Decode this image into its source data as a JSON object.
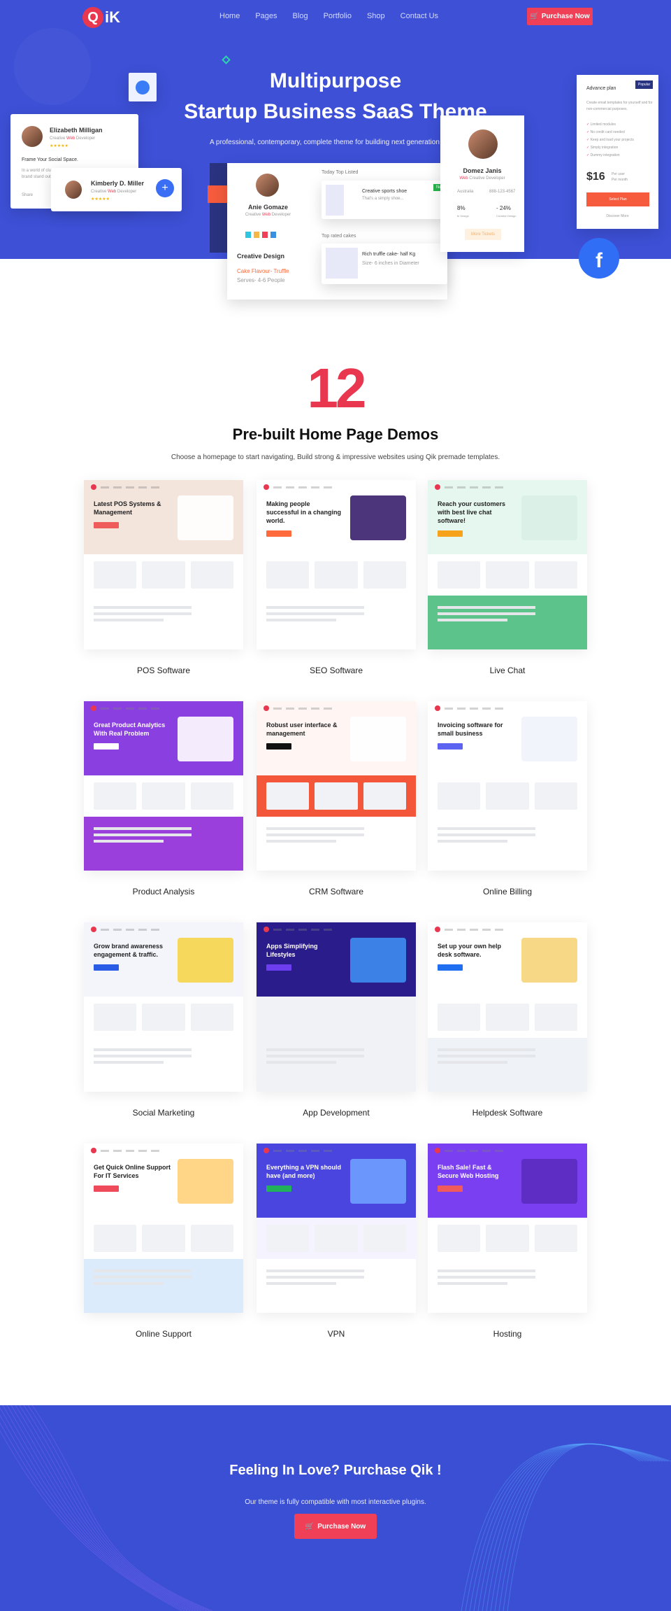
{
  "brand": {
    "logo_letter": "Q",
    "logo_rest": "iK"
  },
  "nav": [
    "Home",
    "Pages",
    "Blog",
    "Portfolio",
    "Shop",
    "Contact Us"
  ],
  "purchase_label": "Purchase Now",
  "colors": {
    "primary": "#3d50d6",
    "accent": "#ef4058",
    "number": "#e8374f"
  },
  "hero": {
    "title_line1": "Multipurpose",
    "title_line2": "Startup Business SaaS Theme",
    "subtitle": "A professional, contemporary, complete theme for building next generation w",
    "profile1": {
      "name": "Elizabeth Milligan",
      "role_pre": "Creative ",
      "role_hl": "Web",
      "role_post": " Developer",
      "heading": "Frame Your Social Space.",
      "text1": "In a world of clu",
      "text2": "brand stand out",
      "share": "Share"
    },
    "profile2": {
      "name": "Kimberly D. Miller",
      "role_pre": "Creative ",
      "role_hl": "Web",
      "role_post": " Developer"
    },
    "dash": {
      "name": "Anie Gomaze",
      "role_pre": "Creative ",
      "role_hl": "Web",
      "role_post": " Developer",
      "section": "Creative Design",
      "flavour": "Cake Flavour- Truffle",
      "serves": "Serves- 4-6 People",
      "list1_title": "Today Top Listed",
      "item1": "Creative sports shoe",
      "item1_sub": "That's a simply shoe...",
      "badge": "New",
      "list2_title": "Top rated cakes",
      "item2": "Rich truffle cake- half Kg",
      "item2_sub": "Size- 6 inches in Diameter"
    },
    "profile3": {
      "name": "Domez Janis",
      "role_hl": "Web",
      "role_post": " Creative Developer",
      "location": "Australia",
      "phone": "888-123-4567",
      "stat1": "8%",
      "stat1_label": "te Design",
      "stat2": "- 24%",
      "stat2_label": "Creative Design",
      "button": "More Tickets"
    },
    "pricing": {
      "plan": "Advance plan",
      "badge": "Popular",
      "desc": "Create email templates for yourself and for non-commercial purposes.",
      "features": [
        "Limited modules",
        "No credit card needed",
        "Keep and load your projects",
        "Simply integration",
        "Dummy integration"
      ],
      "price": "$16",
      "per1": "Per user",
      "per2": "Per month",
      "select": "Select Plan",
      "discover": "Discover More"
    }
  },
  "demos": {
    "number": "12",
    "title": "Pre-built Home Page Demos",
    "subtitle": "Choose a homepage to start navigating, Build strong & impressive websites using Qik premade templates.",
    "items": [
      {
        "label": "POS Software",
        "headline": "Latest POS Systems & Management",
        "top": "#f3e4dc",
        "btn": "#ef5a5a",
        "ill": "#ffffff",
        "mid": "#ffffff",
        "bot": "#ffffff",
        "dark": false
      },
      {
        "label": "SEO Software",
        "headline": "Making people successful in a changing world.",
        "top": "#ffffff",
        "btn": "#ff6a3d",
        "ill": "#3a1f6e",
        "mid": "#ffffff",
        "bot": "#ffffff",
        "dark": false
      },
      {
        "label": "Live Chat",
        "headline": "Reach your customers with best live chat software!",
        "top": "#e6f7f0",
        "btn": "#f7a21b",
        "ill": "#d9efe6",
        "mid": "#ffffff",
        "bot": "#5cc48a",
        "dark": false
      },
      {
        "label": "Product Analysis",
        "headline": "Great Product Analytics With Real Problem",
        "top": "#8a3fe0",
        "btn": "#ffffff",
        "ill": "#ffffff",
        "mid": "#ffffff",
        "bot": "#9b3fdc",
        "dark": true
      },
      {
        "label": "CRM Software",
        "headline": "Robust user interface & management",
        "top": "#fff6f4",
        "btn": "#111111",
        "ill": "#ffffff",
        "mid": "#f4563a",
        "bot": "#ffffff",
        "dark": false
      },
      {
        "label": "Online Billing",
        "headline": "Invoicing software for small business",
        "top": "#ffffff",
        "btn": "#5b63f0",
        "ill": "#f1f3fb",
        "mid": "#ffffff",
        "bot": "#ffffff",
        "dark": false
      },
      {
        "label": "Social Marketing",
        "headline": "Grow brand awareness engagement & traffic.",
        "top": "#f4f5fb",
        "btn": "#2b5ce6",
        "ill": "#f5d54a",
        "mid": "#ffffff",
        "bot": "#ffffff",
        "dark": false
      },
      {
        "label": "App Development",
        "headline": "Apps Simplifying Lifestyles",
        "top": "#2a1c8a",
        "btn": "#6d3df0",
        "ill": "#3d8df0",
        "mid": "#f1f2f6",
        "bot": "#f1f2f6",
        "dark": true
      },
      {
        "label": "Helpdesk Software",
        "headline": "Set up your own help desk software.",
        "top": "#ffffff",
        "btn": "#1f6ff0",
        "ill": "#f6d47a",
        "mid": "#ffffff",
        "bot": "#eff3f8",
        "dark": false
      },
      {
        "label": "Online Support",
        "headline": "Get Quick Online Support For IT Services",
        "top": "#ffffff",
        "btn": "#ef4a5a",
        "ill": "#ffd27a",
        "mid": "#ffffff",
        "bot": "#dcebfb",
        "dark": false
      },
      {
        "label": "VPN",
        "headline": "Everything a VPN should have (and more)",
        "top": "#4b45e0",
        "btn": "#22b05a",
        "ill": "#6fa0ff",
        "mid": "#f4f3ff",
        "bot": "#ffffff",
        "dark": true
      },
      {
        "label": "Hosting",
        "headline": "Flash Sale! Fast & Secure Web Hosting",
        "top": "#7a3ff0",
        "btn": "#ef5a5a",
        "ill": "#5a2bbf",
        "mid": "#ffffff",
        "bot": "#ffffff",
        "dark": true
      }
    ]
  },
  "cta": {
    "title": "Feeling In Love? Purchase Qik !",
    "subtitle": "Our theme is fully compatible with most interactive plugins.",
    "button": "Purchase Now"
  }
}
